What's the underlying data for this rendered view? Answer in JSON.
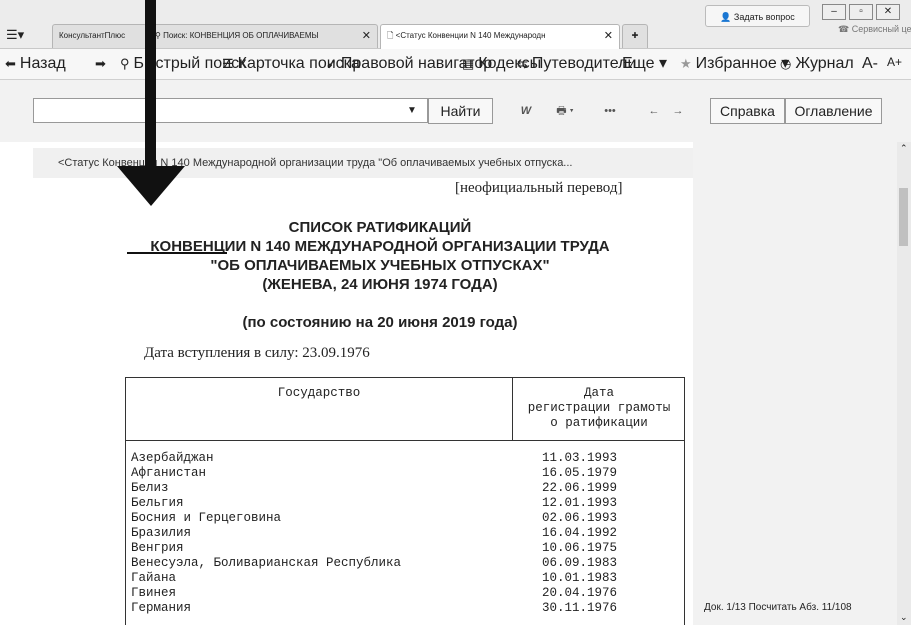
{
  "tabs": [
    {
      "label": "КонсультантПлюс"
    },
    {
      "label": "Поиск: КОНВЕНЦИЯ ОБ ОПЛАЧИВАЕМЫ"
    },
    {
      "label": "<Статус Конвенции N 140 Международн"
    }
  ],
  "ask_question": "Задать вопрос",
  "service_center": "Сервисный центр",
  "toolbar": {
    "back": "Назад",
    "quick_search": "Быстрый поиск",
    "search_card": "Карточка поиска",
    "navigator": "Правовой навигатор",
    "codes": "Кодексы",
    "guides": "Путеводители",
    "more": "Еще",
    "favorites": "Избранное",
    "journal": "Журнал",
    "font_minus": "A-",
    "font_plus": "A+"
  },
  "search": {
    "value": "",
    "find_label": "Найти"
  },
  "help_label": "Справка",
  "contents_label": "Оглавление",
  "breadcrumb": "<Статус Конвенции N 140 Международной организации труда \"Об оплачиваемых учебных отпуска...",
  "doc": {
    "notice": "[неофициальный перевод]",
    "title_lines": [
      "СПИСОК РАТИФИКАЦИЙ",
      "КОНВЕНЦИИ N 140 МЕЖДУНАРОДНОЙ ОРГАНИЗАЦИИ ТРУДА",
      "\"ОБ ОПЛАЧИВАЕМЫХ УЧЕБНЫХ ОТПУСКАХ\"",
      "(ЖЕНЕВА, 24 ИЮНЯ 1974 ГОДА)"
    ],
    "state_date": "(по состоянию на 20 июня 2019 года)",
    "entry_into_force": "Дата вступления в силу: 23.09.1976",
    "table": {
      "col1": "Государство",
      "col2_lines": [
        "Дата",
        "регистрации грамоты",
        "о ратификации"
      ],
      "rows": [
        {
          "state": "Азербайджан",
          "date": "11.03.1993"
        },
        {
          "state": "Афганистан",
          "date": "16.05.1979"
        },
        {
          "state": "Белиз",
          "date": "22.06.1999"
        },
        {
          "state": "Бельгия",
          "date": "12.01.1993"
        },
        {
          "state": "Босния и Герцеговина",
          "date": "02.06.1993"
        },
        {
          "state": "Бразилия",
          "date": "16.04.1992"
        },
        {
          "state": "Венгрия",
          "date": "10.06.1975"
        },
        {
          "state": "Венесуэла, Боливарианская Республика",
          "date": "06.09.1983"
        },
        {
          "state": "Гайана",
          "date": "10.01.1983"
        },
        {
          "state": "Гвинея",
          "date": "20.04.1976"
        },
        {
          "state": "Германия",
          "date": "30.11.1976"
        }
      ]
    }
  },
  "status": "Док. 1/13 Посчитать Абз. 11/108"
}
